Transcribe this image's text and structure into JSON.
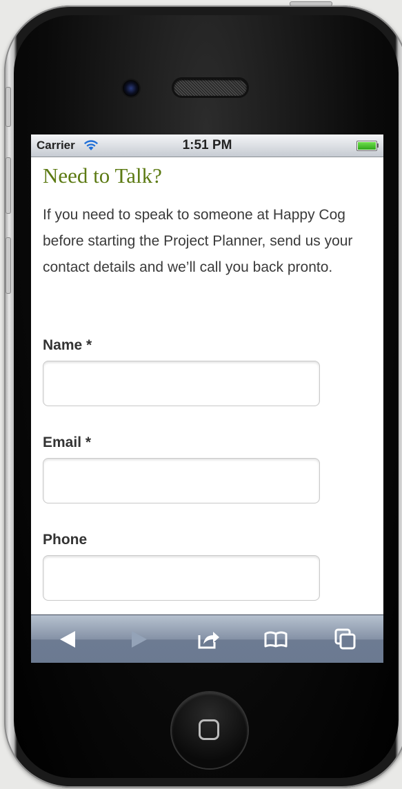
{
  "status_bar": {
    "carrier": "Carrier",
    "time": "1:51 PM",
    "wifi_icon": "wifi-icon",
    "battery_icon": "battery-icon",
    "battery_level": 1.0
  },
  "page": {
    "heading": "Need to Talk?",
    "intro": "If you need to speak to someone at Happy Cog before starting the Project Planner, send us your contact details and we’ll call you back pronto."
  },
  "form": {
    "name": {
      "label": "Name *",
      "value": "",
      "placeholder": ""
    },
    "email": {
      "label": "Email *",
      "value": "",
      "placeholder": ""
    },
    "phone": {
      "label": "Phone",
      "value": "",
      "placeholder": ""
    }
  },
  "toolbar": {
    "back_icon": "back-arrow-icon",
    "forward_icon": "forward-arrow-icon",
    "share_icon": "share-icon",
    "bookmarks_icon": "bookmarks-icon",
    "tabs_icon": "tabs-icon"
  },
  "colors": {
    "heading": "#5c7a13",
    "body_text": "#3a3a3a",
    "toolbar": "#8592a6"
  }
}
